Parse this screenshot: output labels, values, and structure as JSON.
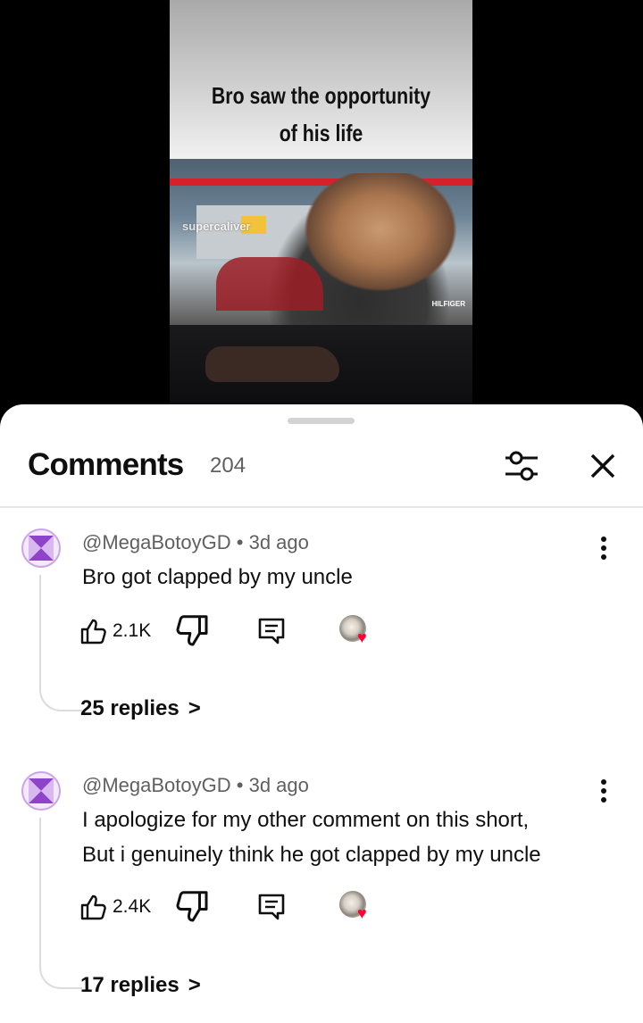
{
  "video": {
    "caption_line1": "Bro saw the opportunity",
    "caption_line2": "of his life",
    "watermark": "supercaliver",
    "brand_text": "HILFIGER"
  },
  "comments_panel": {
    "title": "Comments",
    "count": "204",
    "filter_icon": "sliders-icon",
    "close_icon": "close-icon"
  },
  "comments": [
    {
      "author": "@MegaBotoyGD",
      "age": "3d ago",
      "text_lines": [
        "Bro got clapped by my uncle"
      ],
      "likes": "2.1K",
      "replies_label": "25 replies"
    },
    {
      "author": "@MegaBotoyGD",
      "age": "3d ago",
      "text_lines": [
        "I apologize for my other comment on this short,",
        "But i genuinely think he got clapped by my uncle"
      ],
      "likes": "2.4K",
      "replies_label": "17 replies"
    }
  ],
  "colors": {
    "accent_heart": "#ff0033",
    "secondary_text": "#606060",
    "avatar_purple": "#8e44c9"
  }
}
